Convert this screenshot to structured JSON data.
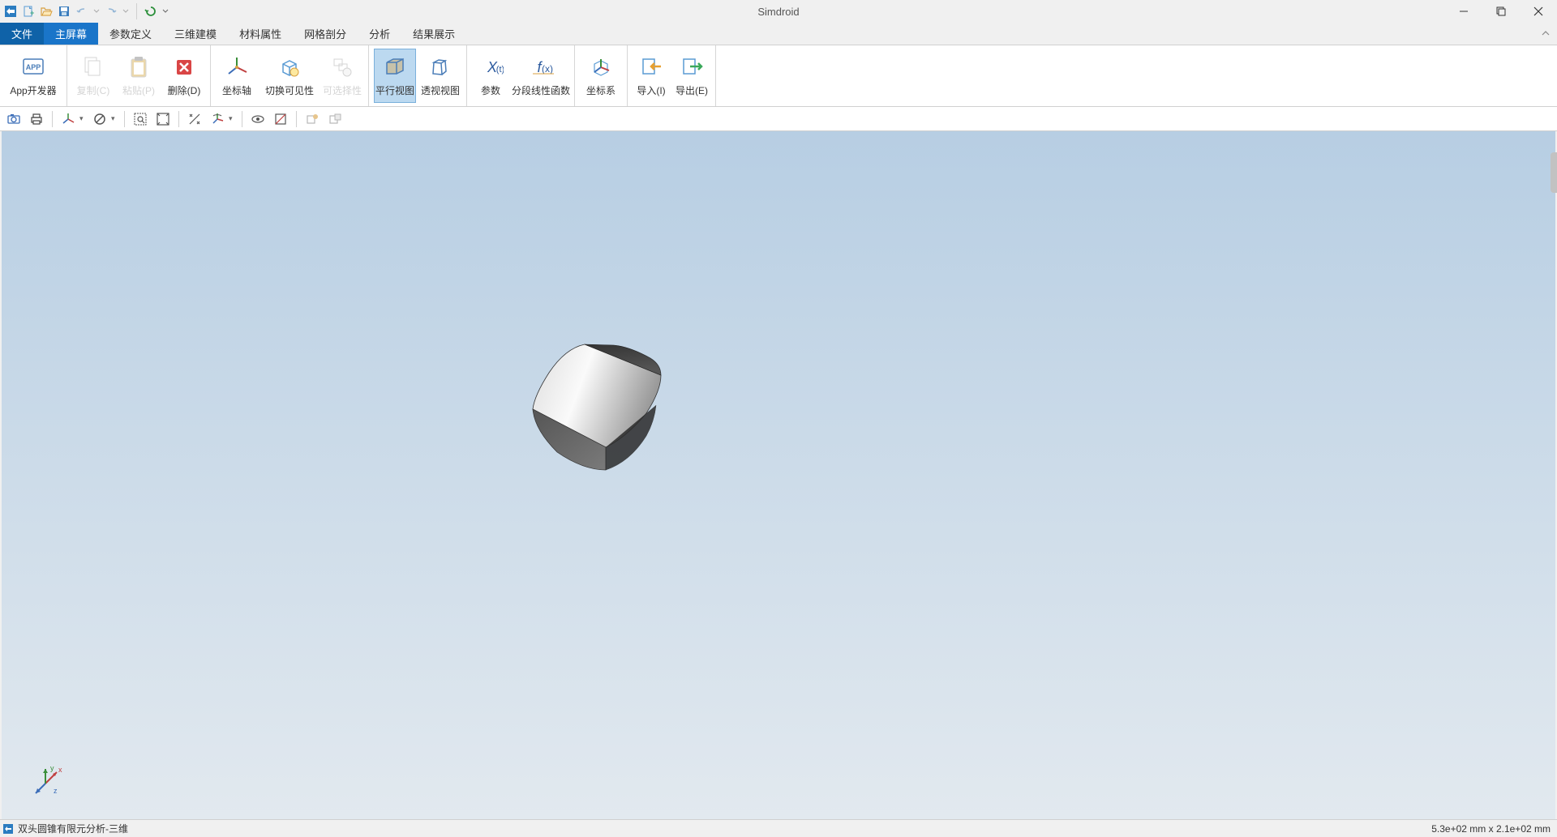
{
  "app": {
    "title": "Simdroid"
  },
  "tabs": {
    "file": "文件",
    "items": [
      "主屏幕",
      "参数定义",
      "三维建模",
      "材料属性",
      "网格剖分",
      "分析",
      "结果展示"
    ],
    "activeIndex": 0
  },
  "ribbon": {
    "appdev": "App开发器",
    "copy": "复制(C)",
    "paste": "粘贴(P)",
    "delete": "删除(D)",
    "axis": "坐标轴",
    "togglevis": "切换可见性",
    "selectable": "可选择性",
    "parallel": "平行视图",
    "perspective": "透视视图",
    "param": "参数",
    "piecewise": "分段线性函数",
    "coord": "坐标系",
    "import": "导入(I)",
    "export": "导出(E)"
  },
  "status": {
    "doc": "双头圆锥有限元分析-三维",
    "dims": "5.3e+02 mm x 2.1e+02 mm"
  },
  "axis_labels": {
    "x": "x",
    "y": "y",
    "z": "z"
  }
}
